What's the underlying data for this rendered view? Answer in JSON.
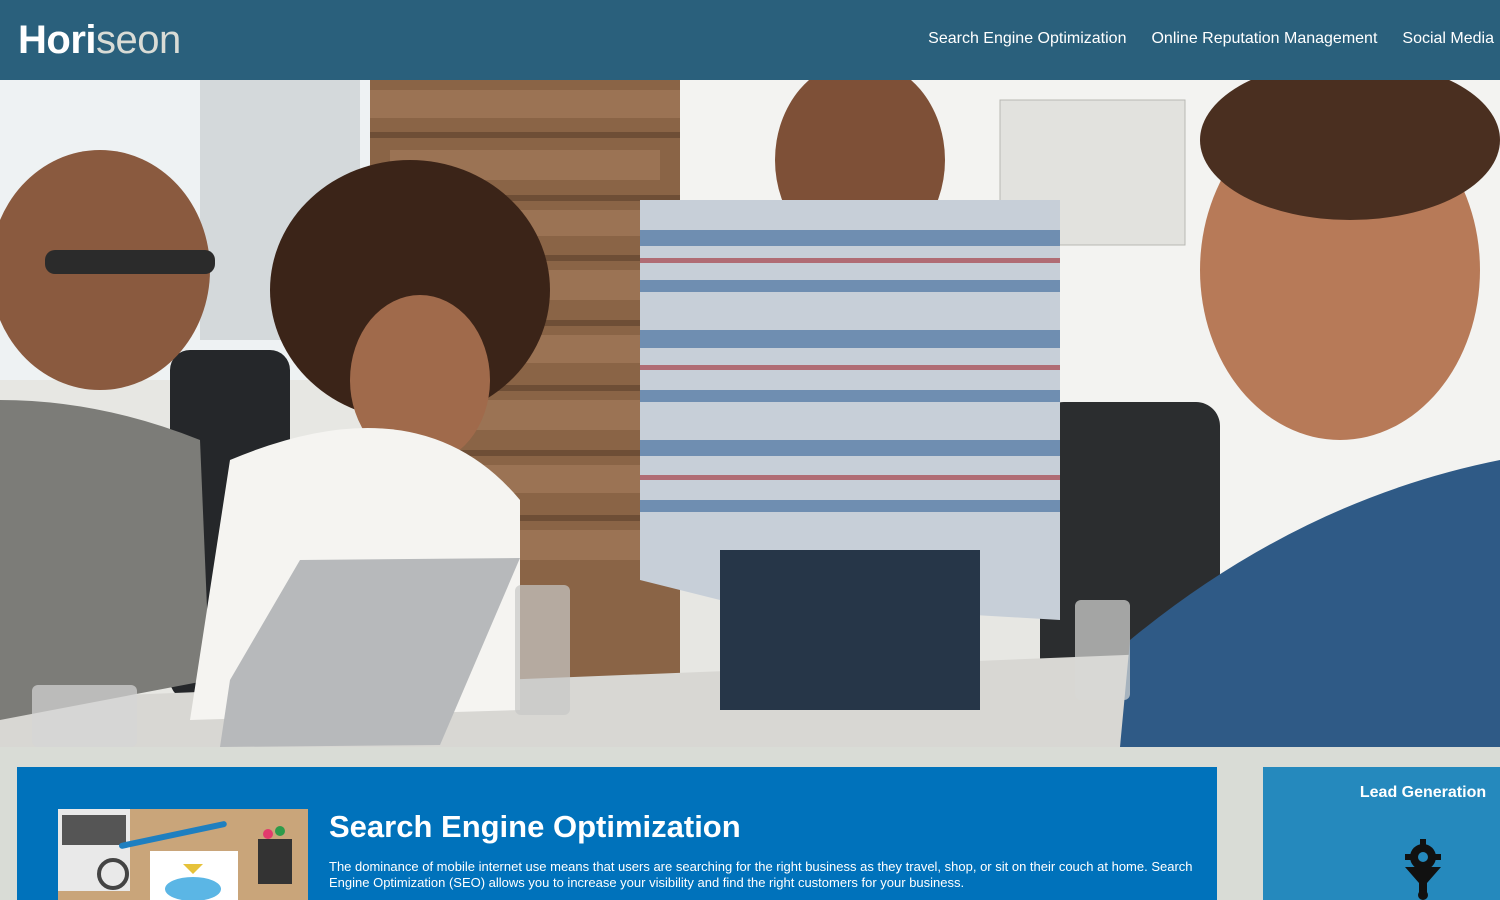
{
  "header": {
    "logo_prefix": "Hori",
    "logo_suffix": "seon",
    "nav": [
      {
        "label": "Search Engine Optimization"
      },
      {
        "label": "Online Reputation Management"
      },
      {
        "label": "Social Media"
      }
    ]
  },
  "hero": {
    "image_icon": "team-meeting-photo"
  },
  "main": {
    "section_title": "Search Engine Optimization",
    "section_text": "The dominance of mobile internet use means that users are searching for the right business as they travel, shop, or sit on their couch at home. Search Engine Optimization (SEO) allows you to increase your visibility and find the right customers for your business.",
    "thumb_icon": "seo-desk-photo"
  },
  "aside": {
    "title": "Lead Generation",
    "icon": "lead-funnel-gear-icon"
  },
  "colors": {
    "header_bg": "#2a607c",
    "page_bg": "#d9dcd6",
    "card_bg": "#0072bb",
    "aside_bg": "#2589bd"
  }
}
